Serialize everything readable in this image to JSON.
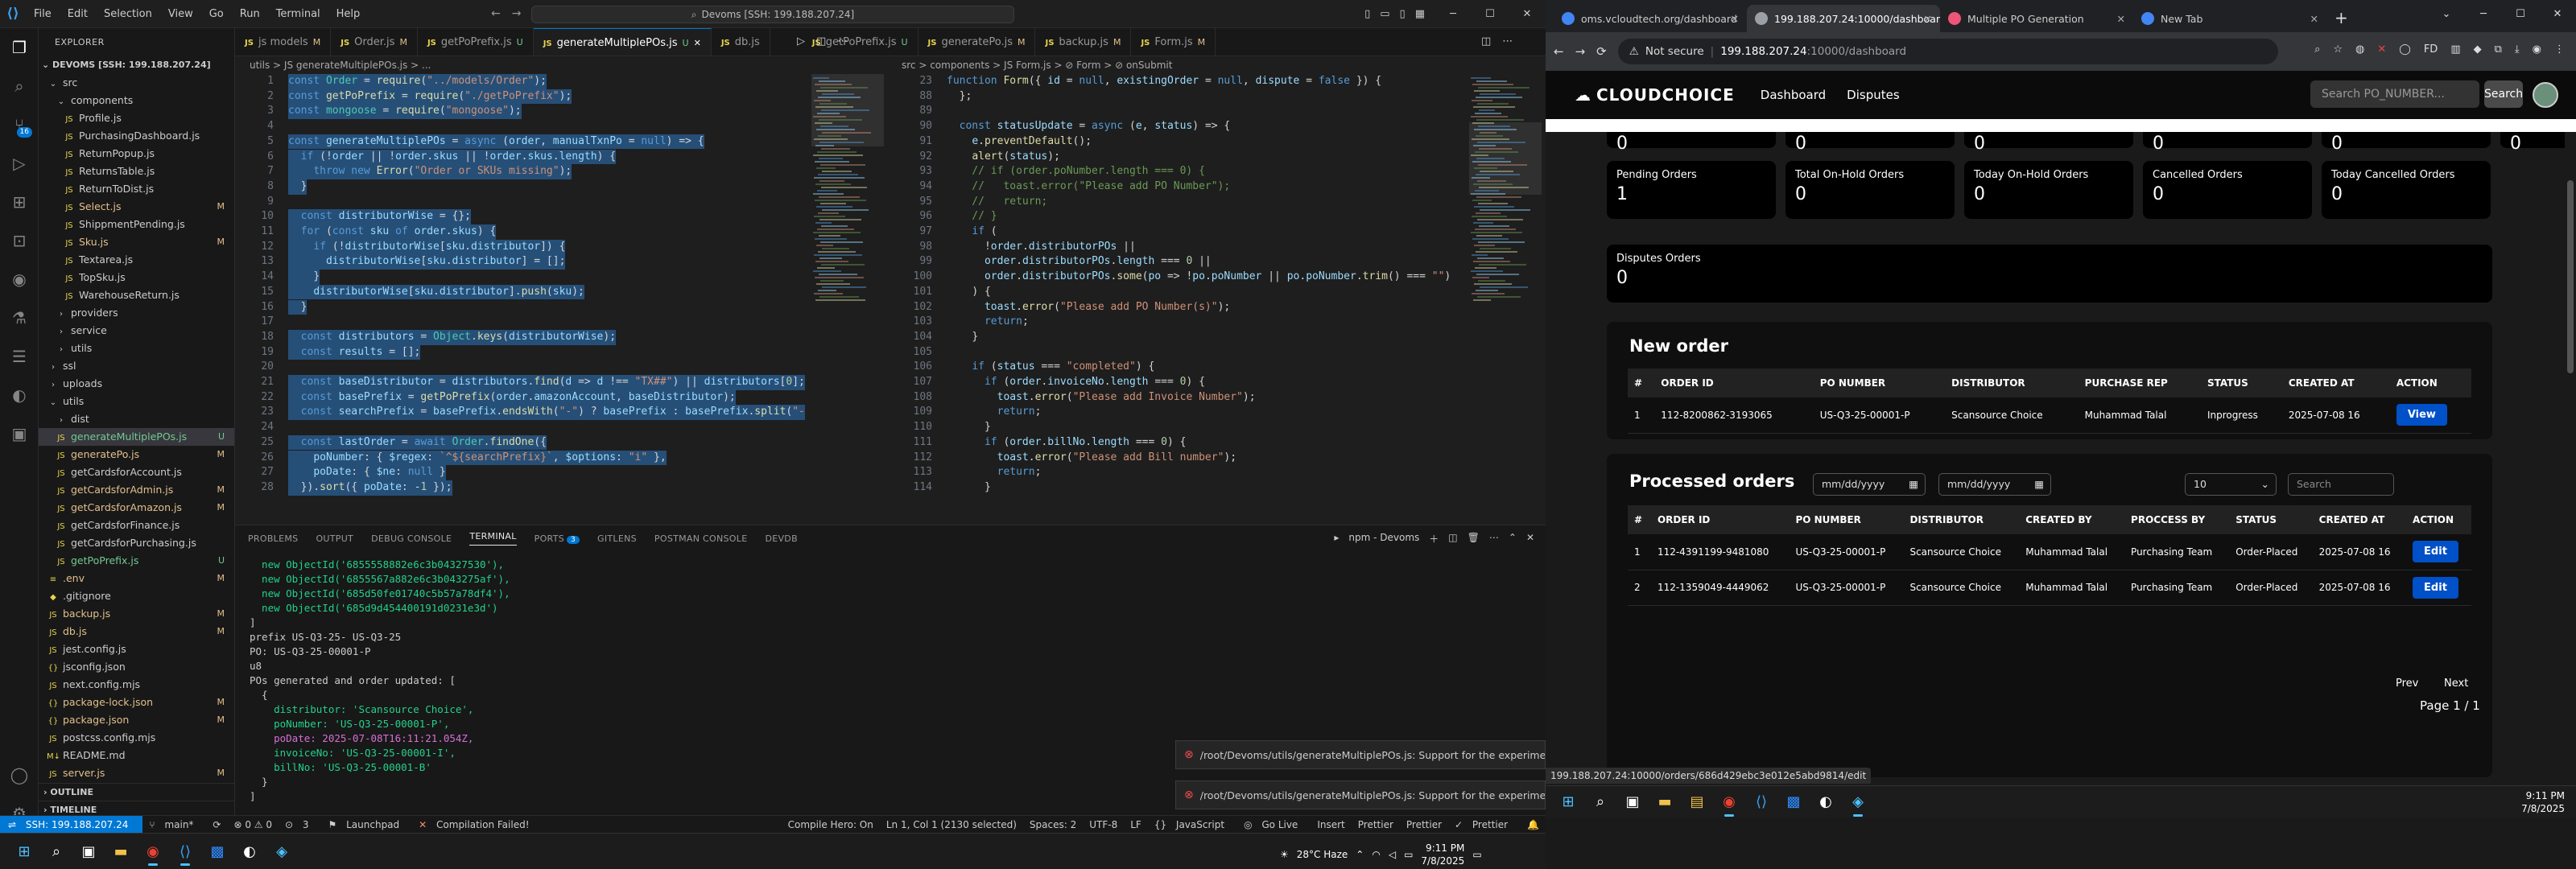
{
  "vscode": {
    "menu": [
      "File",
      "Edit",
      "Selection",
      "View",
      "Go",
      "Run",
      "Terminal",
      "Help"
    ],
    "search": "Devoms [SSH: 199.188.207.24]",
    "explorer": {
      "title": "EXPLORER",
      "root": "DEVOMS [SSH: 199.188.207.24]",
      "items": [
        {
          "name": "src",
          "type": "folder",
          "indent": 1,
          "status": ""
        },
        {
          "name": "components",
          "type": "folder",
          "indent": 2,
          "status": ""
        },
        {
          "name": "Profile.js",
          "type": "js",
          "indent": 3,
          "status": ""
        },
        {
          "name": "PurchasingDashboard.js",
          "type": "js",
          "indent": 3,
          "status": ""
        },
        {
          "name": "ReturnPopup.js",
          "type": "js",
          "indent": 3,
          "status": ""
        },
        {
          "name": "ReturnsTable.js",
          "type": "js",
          "indent": 3,
          "status": ""
        },
        {
          "name": "ReturnToDist.js",
          "type": "js",
          "indent": 3,
          "status": ""
        },
        {
          "name": "Select.js",
          "type": "js",
          "indent": 3,
          "status": "M"
        },
        {
          "name": "ShippmentPending.js",
          "type": "js",
          "indent": 3,
          "status": ""
        },
        {
          "name": "Sku.js",
          "type": "js",
          "indent": 3,
          "status": "M"
        },
        {
          "name": "Textarea.js",
          "type": "js",
          "indent": 3,
          "status": ""
        },
        {
          "name": "TopSku.js",
          "type": "js",
          "indent": 3,
          "status": ""
        },
        {
          "name": "WarehouseReturn.js",
          "type": "js",
          "indent": 3,
          "status": ""
        },
        {
          "name": "providers",
          "type": "folder",
          "indent": 2,
          "status": ""
        },
        {
          "name": "service",
          "type": "folder",
          "indent": 2,
          "status": ""
        },
        {
          "name": "utils",
          "type": "folder",
          "indent": 2,
          "status": ""
        },
        {
          "name": "ssl",
          "type": "folder",
          "indent": 1,
          "status": ""
        },
        {
          "name": "uploads",
          "type": "folder",
          "indent": 1,
          "status": ""
        },
        {
          "name": "utils",
          "type": "folder",
          "indent": 1,
          "status": ""
        },
        {
          "name": "dist",
          "type": "folder",
          "indent": 2,
          "status": ""
        },
        {
          "name": "generateMultiplePOs.js",
          "type": "js",
          "indent": 2,
          "status": "U",
          "selected": true
        },
        {
          "name": "generatePo.js",
          "type": "js",
          "indent": 2,
          "status": "M"
        },
        {
          "name": "getCardsforAccount.js",
          "type": "js",
          "indent": 2,
          "status": ""
        },
        {
          "name": "getCardsforAdmin.js",
          "type": "js",
          "indent": 2,
          "status": "M"
        },
        {
          "name": "getCardsforAmazon.js",
          "type": "js",
          "indent": 2,
          "status": "M"
        },
        {
          "name": "getCardsforFinance.js",
          "type": "js",
          "indent": 2,
          "status": ""
        },
        {
          "name": "getCardsforPurchasing.js",
          "type": "js",
          "indent": 2,
          "status": ""
        },
        {
          "name": "getPoPrefix.js",
          "type": "js",
          "indent": 2,
          "status": "U"
        },
        {
          "name": ".env",
          "type": "mod",
          "indent": 1,
          "status": "M"
        },
        {
          "name": ".gitignore",
          "type": "plain",
          "indent": 1,
          "status": ""
        },
        {
          "name": "backup.js",
          "type": "js",
          "indent": 1,
          "status": "M"
        },
        {
          "name": "db.js",
          "type": "js",
          "indent": 1,
          "status": "M"
        },
        {
          "name": "jest.config.js",
          "type": "js",
          "indent": 1,
          "status": ""
        },
        {
          "name": "jsconfig.json",
          "type": "json",
          "indent": 1,
          "status": ""
        },
        {
          "name": "next.config.mjs",
          "type": "js",
          "indent": 1,
          "status": ""
        },
        {
          "name": "package-lock.json",
          "type": "json",
          "indent": 1,
          "status": "M"
        },
        {
          "name": "package.json",
          "type": "json",
          "indent": 1,
          "status": "M"
        },
        {
          "name": "postcss.config.mjs",
          "type": "js",
          "indent": 1,
          "status": ""
        },
        {
          "name": "README.md",
          "type": "md",
          "indent": 1,
          "status": ""
        },
        {
          "name": "server.js",
          "type": "js",
          "indent": 1,
          "status": "M"
        }
      ],
      "outline": "OUTLINE",
      "timeline": "TIMELINE"
    },
    "tabs": [
      {
        "label": "js models",
        "status": "M",
        "active": false
      },
      {
        "label": "Order.js",
        "status": "M",
        "active": false
      },
      {
        "label": "getPoPrefix.js",
        "status": "U",
        "active": false
      },
      {
        "label": "generateMultiplePOs.js",
        "status": "U",
        "active": true
      },
      {
        "label": "db.js",
        "status": "",
        "active": false
      },
      {
        "label": "getPoPrefix.js",
        "status": "U",
        "active": false
      },
      {
        "label": "generatePo.js",
        "status": "M",
        "active": false
      },
      {
        "label": "backup.js",
        "status": "M",
        "active": false
      },
      {
        "label": "Form.js",
        "status": "M",
        "active": false
      }
    ],
    "breadcrumb_left": "utils > JS generateMultiplePOs.js > ...",
    "breadcrumb_right": "src > components > JS Form.js > ⊘ Form > ⊘ onSubmit",
    "left_code": [
      {
        "n": "1",
        "t": "const Order = require(\"../models/Order\");"
      },
      {
        "n": "2",
        "t": "const getPoPrefix = require(\"./getPoPrefix\");"
      },
      {
        "n": "3",
        "t": "const mongoose = require(\"mongoose\");"
      },
      {
        "n": "4",
        "t": ""
      },
      {
        "n": "5",
        "t": "const generateMultiplePOs = async (order, manualTxnPo = null) => {"
      },
      {
        "n": "6",
        "t": "  if (!order || !order.skus || !order.skus.length) {"
      },
      {
        "n": "7",
        "t": "    throw new Error(\"Order or SKUs missing\");"
      },
      {
        "n": "8",
        "t": "  }"
      },
      {
        "n": "9",
        "t": ""
      },
      {
        "n": "10",
        "t": "  const distributorWise = {};"
      },
      {
        "n": "11",
        "t": "  for (const sku of order.skus) {"
      },
      {
        "n": "12",
        "t": "    if (!distributorWise[sku.distributor]) {"
      },
      {
        "n": "13",
        "t": "      distributorWise[sku.distributor] = [];"
      },
      {
        "n": "14",
        "t": "    }"
      },
      {
        "n": "15",
        "t": "    distributorWise[sku.distributor].push(sku);"
      },
      {
        "n": "16",
        "t": "  }"
      },
      {
        "n": "17",
        "t": ""
      },
      {
        "n": "18",
        "t": "  const distributors = Object.keys(distributorWise);"
      },
      {
        "n": "19",
        "t": "  const results = [];"
      },
      {
        "n": "20",
        "t": ""
      },
      {
        "n": "21",
        "t": "  const baseDistributor = distributors.find(d => d !== \"TX##\") || distributors[0];"
      },
      {
        "n": "22",
        "t": "  const basePrefix = getPoPrefix(order.amazonAccount, baseDistributor);"
      },
      {
        "n": "23",
        "t": "  const searchPrefix = basePrefix.endsWith(\"-\") ? basePrefix : basePrefix.split(\"-"
      },
      {
        "n": "24",
        "t": ""
      },
      {
        "n": "25",
        "t": "  const lastOrder = await Order.findOne({"
      },
      {
        "n": "26",
        "t": "    poNumber: { $regex: `^${searchPrefix}`, $options: \"i\" },"
      },
      {
        "n": "27",
        "t": "    poDate: { $ne: null }"
      },
      {
        "n": "28",
        "t": "  }).sort({ poDate: -1 });"
      }
    ],
    "right_code": [
      {
        "n": "23",
        "t": "function Form({ id = null, existingOrder = null, dispute = false }) {"
      },
      {
        "n": "88",
        "t": "  };"
      },
      {
        "n": "89",
        "t": ""
      },
      {
        "n": "90",
        "t": "  const statusUpdate = async (e, status) => {"
      },
      {
        "n": "91",
        "t": "    e.preventDefault();"
      },
      {
        "n": "92",
        "t": "    alert(status);"
      },
      {
        "n": "93",
        "t": "    // if (order.poNumber.length === 0) {"
      },
      {
        "n": "94",
        "t": "    //   toast.error(\"Please add PO Number\");"
      },
      {
        "n": "95",
        "t": "    //   return;"
      },
      {
        "n": "96",
        "t": "    // }"
      },
      {
        "n": "97",
        "t": "    if ("
      },
      {
        "n": "98",
        "t": "      !order.distributorPOs ||"
      },
      {
        "n": "99",
        "t": "      order.distributorPOs.length === 0 ||"
      },
      {
        "n": "100",
        "t": "      order.distributorPOs.some(po => !po.poNumber || po.poNumber.trim() === \"\")"
      },
      {
        "n": "101",
        "t": "    ) {"
      },
      {
        "n": "102",
        "t": "      toast.error(\"Please add PO Number(s)\");"
      },
      {
        "n": "103",
        "t": "      return;"
      },
      {
        "n": "104",
        "t": "    }"
      },
      {
        "n": "105",
        "t": ""
      },
      {
        "n": "106",
        "t": "    if (status === \"completed\") {"
      },
      {
        "n": "107",
        "t": "      if (order.invoiceNo.length === 0) {"
      },
      {
        "n": "108",
        "t": "        toast.error(\"Please add Invoice Number\");"
      },
      {
        "n": "109",
        "t": "        return;"
      },
      {
        "n": "110",
        "t": "      }"
      },
      {
        "n": "111",
        "t": "      if (order.billNo.length === 0) {"
      },
      {
        "n": "112",
        "t": "        toast.error(\"Please add Bill number\");"
      },
      {
        "n": "113",
        "t": "        return;"
      },
      {
        "n": "114",
        "t": "      }"
      }
    ],
    "panel_tabs": [
      "PROBLEMS",
      "OUTPUT",
      "DEBUG CONSOLE",
      "TERMINAL",
      "PORTS",
      "GITLENS",
      "POSTMAN CONSOLE",
      "DEVDB"
    ],
    "ports_badge": "3",
    "terminal_name": "npm - Devoms",
    "terminal_lines": [
      "  new ObjectId('6855558882e6c3b04327530'),",
      "  new ObjectId('6855567a882e6c3b043275af'),",
      "  new ObjectId('685d50fe01740c5b57a78df4'),",
      "  new ObjectId('685d9d454400191d0231e3d')",
      "]",
      "prefix US-Q3-25- US-Q3-25",
      "PO: US-Q3-25-00001-P",
      "u8",
      "POs generated and order updated: [",
      "  {",
      "    distributor: 'Scansource Choice',",
      "    poNumber: 'US-Q3-25-00001-P',",
      "    poDate: 2025-07-08T16:11:21.054Z,",
      "    invoiceNo: 'US-Q3-25-00001-I',",
      "    billNo: 'US-Q3-25-00001-B'",
      "  }",
      "]"
    ],
    "toasts": [
      "/root/Devoms/utils/generateMultiplePOs.js: Support for the experime...",
      "/root/Devoms/utils/generateMultiplePOs.js: Support for the experime..."
    ],
    "status_bar": {
      "remote": "SSH: 199.188.207.24",
      "branch": "main*",
      "errors": "⊗ 0 ⚠ 0",
      "ports": "3",
      "launchpad": "Launchpad",
      "compile": "Compilation Failed!",
      "compile_hero": "Compile Hero: On",
      "position": "Ln 1, Col 1 (2130 selected)",
      "spaces": "Spaces: 2",
      "encoding": "UTF-8",
      "eol": "LF",
      "language": "JavaScript",
      "golive": "Go Live",
      "insert": "Insert",
      "prettier1": "Prettier",
      "prettier2": "Prettier",
      "prettier3": "Prettier"
    },
    "taskbar": {
      "weather": "28°C Haze",
      "time": "9:11 PM",
      "date": "7/8/2025"
    }
  },
  "chrome": {
    "tabs": [
      {
        "title": "oms.vcloudtech.org/dashboard",
        "active": false,
        "color": "#4285f4"
      },
      {
        "title": "199.188.207.24:10000/dashboard",
        "active": true,
        "color": "#9aa0a6"
      },
      {
        "title": "Multiple PO Generation",
        "active": false,
        "color": "#e57"
      },
      {
        "title": "New Tab",
        "active": false,
        "color": "#4285f4"
      }
    ],
    "not_secure": "Not secure",
    "url_host": "199.188.207.24",
    "url_path": ":10000/dashboard",
    "hover_url": "199.188.207.24:10000/orders/686d429ebc3e012e5abd9814/edit",
    "app": {
      "logo": "CLOUDCHOICE",
      "nav": [
        "Dashboard",
        "Disputes"
      ],
      "search_placeholder": "Search PO_NUMBER...",
      "search_button": "Search",
      "top_row": [
        "0",
        "0",
        "0",
        "0",
        "0",
        "0"
      ],
      "cards": [
        {
          "label": "Pending Orders",
          "value": "1"
        },
        {
          "label": "Total On-Hold Orders",
          "value": "0"
        },
        {
          "label": "Today On-Hold Orders",
          "value": "0"
        },
        {
          "label": "Cancelled Orders",
          "value": "0"
        },
        {
          "label": "Today Cancelled Orders",
          "value": "0"
        }
      ],
      "dispute_card": {
        "label": "Disputes Orders",
        "value": "0"
      },
      "new_order": {
        "title": "New order",
        "headers": [
          "#",
          "ORDER ID",
          "PO NUMBER",
          "DISTRIBUTOR",
          "PURCHASE REP",
          "STATUS",
          "CREATED AT",
          "ACTION"
        ],
        "rows": [
          {
            "num": "1",
            "order_id": "112-8200862-3193065",
            "po": "US-Q3-25-00001-P",
            "distributor": "Scansource Choice",
            "rep": "Muhammad Talal",
            "status": "Inprogress",
            "created": "2025-07-08 16",
            "action": "View"
          }
        ]
      },
      "processed": {
        "title": "Processed orders",
        "date_from": "mm/dd/yyyy",
        "date_to": "mm/dd/yyyy",
        "page_size": "10",
        "search_placeholder": "Search",
        "headers": [
          "#",
          "ORDER ID",
          "PO NUMBER",
          "DISTRIBUTOR",
          "CREATED BY",
          "PROCCESS BY",
          "STATUS",
          "CREATED AT",
          "ACTION"
        ],
        "rows": [
          {
            "num": "1",
            "order_id": "112-4391199-9481080",
            "po": "US-Q3-25-00001-P",
            "distributor": "Scansource Choice",
            "created_by": "Muhammad Talal",
            "process_by": "Purchasing Team",
            "status": "Order-Placed",
            "created": "2025-07-08 16",
            "action": "Edit"
          },
          {
            "num": "2",
            "order_id": "112-1359049-4449062",
            "po": "US-Q3-25-00001-P",
            "distributor": "Scansource Choice",
            "created_by": "Muhammad Talal",
            "process_by": "Purchasing Team",
            "status": "Order-Placed",
            "created": "2025-07-08 16",
            "action": "Edit"
          }
        ],
        "prev": "Prev",
        "next": "Next",
        "page_info": "Page 1 / 1"
      }
    },
    "taskbar": {
      "time": "9:11 PM",
      "date": "7/8/2025"
    }
  }
}
